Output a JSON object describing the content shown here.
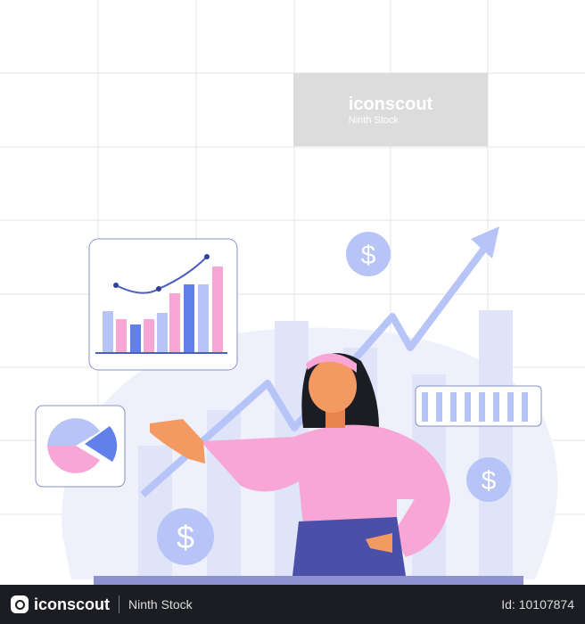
{
  "watermark": {
    "brand": "iconscout",
    "author": "Ninth Stock"
  },
  "footer": {
    "brand": "iconscout",
    "author": "Ninth Stock",
    "id": "Id: 10107874"
  },
  "icons": [
    "dollar-coin-icon",
    "trend-arrow-icon",
    "bar-chart-card",
    "pie-chart-card",
    "progress-bars-card"
  ],
  "colors": {
    "pink": "#f8a6d5",
    "blue": "#6180e8",
    "light_blue": "#b6c4f7",
    "navy": "#4a4fa8",
    "footer": "#1b1d23"
  }
}
